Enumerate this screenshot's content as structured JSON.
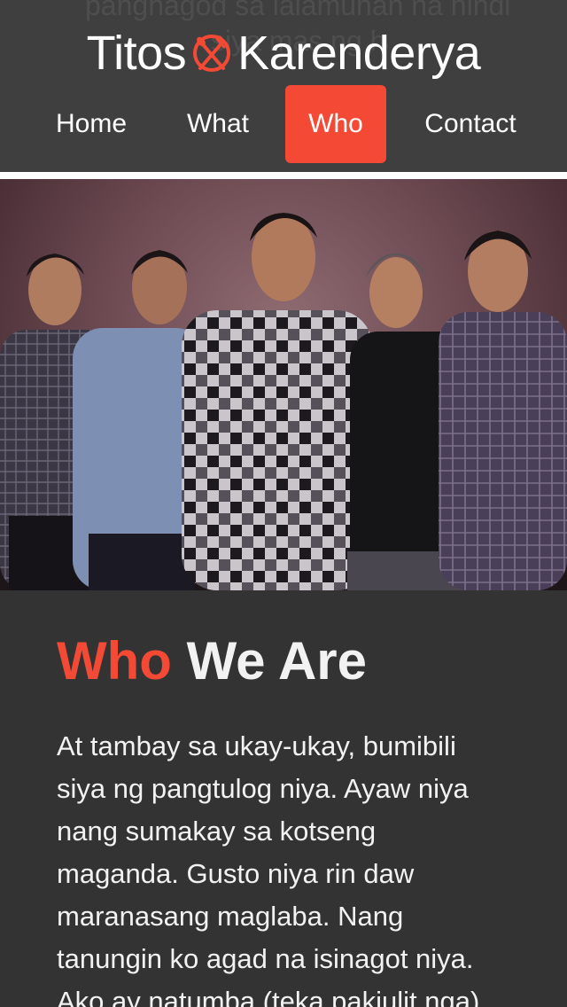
{
  "header": {
    "ghost_line_1": "panghagod sa lalamunan na hindi",
    "ghost_line_2": "siya mas ng han",
    "brand_left": "Titos",
    "brand_right": "Karenderya",
    "logo_icon": "fork-knife-plate-icon",
    "accent_color": "#f44a35"
  },
  "nav": {
    "items": [
      {
        "label": "Home"
      },
      {
        "label": "What"
      },
      {
        "label": "Who"
      },
      {
        "label": "Contact"
      }
    ],
    "active_label": "Who"
  },
  "hero": {
    "image": "band-group-photo"
  },
  "section": {
    "title_accent": "Who",
    "title_rest": "We Are",
    "body": "At tambay sa ukay-ukay, bumibili siya ng pangtulog niya. Ayaw niya nang sumakay sa kotseng maganda. Gusto niya rin daw maranasang maglaba. Nang tanungin ko agad na isinagot niya. Ako ay natumba (teka pakiulit nga)"
  }
}
